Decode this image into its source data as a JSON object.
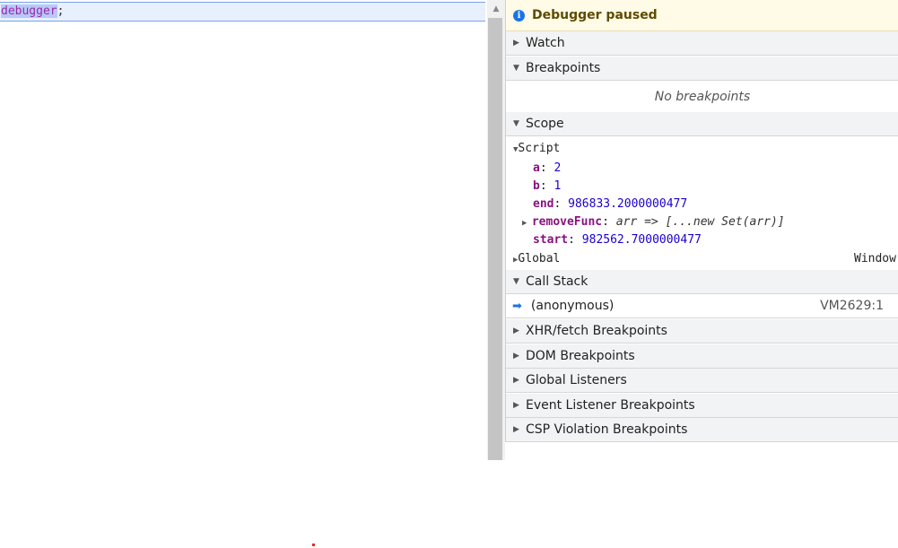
{
  "editor": {
    "keyword": "debugger",
    "punct": ";"
  },
  "scrollbar": {
    "up_icon": "arrow-up-icon"
  },
  "debugger": {
    "paused_text": "Debugger paused",
    "info_icon": "info-icon",
    "sections": {
      "watch": "Watch",
      "breakpoints": "Breakpoints",
      "scope": "Scope",
      "call_stack": "Call Stack",
      "xhr": "XHR/fetch Breakpoints",
      "dom": "DOM Breakpoints",
      "global_listeners": "Global Listeners",
      "event_listener": "Event Listener Breakpoints",
      "csp": "CSP Violation Breakpoints"
    },
    "no_breakpoints": "No breakpoints",
    "scope": {
      "script_label": "Script",
      "vars": [
        {
          "name": "a",
          "value": "2"
        },
        {
          "name": "b",
          "value": "1"
        },
        {
          "name": "end",
          "value": "986833.2000000477"
        },
        {
          "name": "removeFunc",
          "value": "arr => [...new Set(arr)]"
        },
        {
          "name": "start",
          "value": "982562.7000000477"
        }
      ],
      "global_label": "Global",
      "global_value": "Window"
    },
    "call_stack": {
      "frame_name": "(anonymous)",
      "frame_location": "VM2629:1"
    }
  }
}
